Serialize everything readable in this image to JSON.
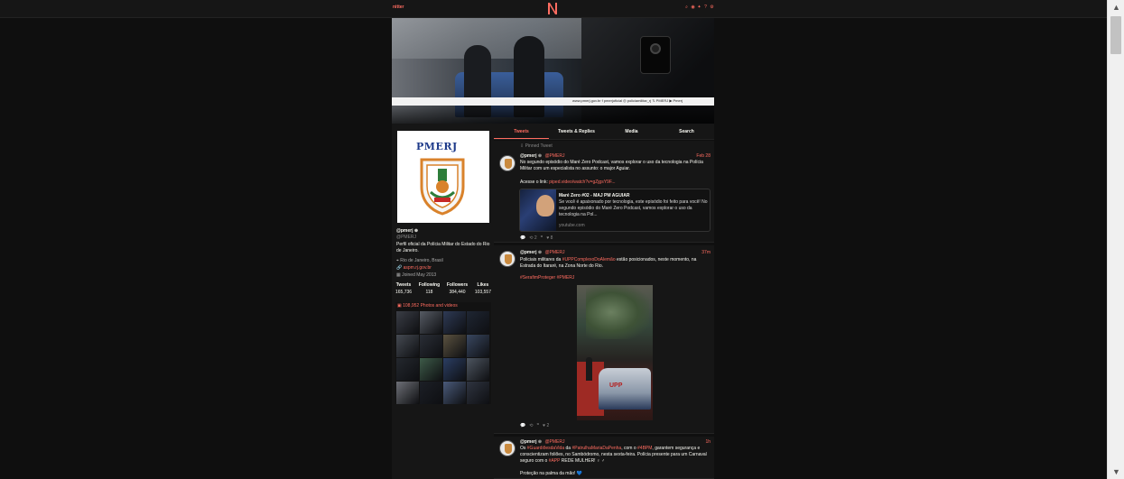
{
  "nav": {
    "brand": "nitter",
    "icons": [
      "search-icon",
      "rss-icon",
      "twitter-icon",
      "info-icon",
      "settings-icon"
    ],
    "icon_glyphs": [
      "⌕",
      "◉",
      "✦",
      "?",
      "⚙"
    ]
  },
  "banner": {
    "strip_text": "www.pmerj.gov.br   f pmerjoficial   ◎ policiamilitar_rj   𝕏 PMERJ   ▶ Pmerj"
  },
  "profile": {
    "logo_text": "PMERJ",
    "fullname": "@pmerj",
    "handle": "@PMERJ",
    "bio": "Perfil oficial da Polícia Militar do Estado do Rio de Janeiro.",
    "location": "Rio de Janeiro, Brasil",
    "website": "aspm.rj.gov.br",
    "joined": "Joined May 2013",
    "stats": [
      {
        "label": "Tweets",
        "value": "165,736"
      },
      {
        "label": "Following",
        "value": "118"
      },
      {
        "label": "Followers",
        "value": "384,440"
      },
      {
        "label": "Likes",
        "value": "103,557"
      }
    ],
    "media_label": "108,952 Photos and videos"
  },
  "tabs": [
    "Tweets",
    "Tweets & Replies",
    "Media",
    "Search"
  ],
  "tweets": [
    {
      "pinned": "Pinned Tweet",
      "fullname": "@pmerj",
      "username": "@PMERJ",
      "date": "Feb 28",
      "text1": "No segundo episódio do Maré Zero Podcast, vamos explorar o uso da tecnologia na Polícia Militar com um especialista no assunto: o major Aguiar.",
      "text2": "Acesse o link: ",
      "link": "piped.video/watch?v=gZjgsY9F...",
      "card": {
        "title": "Maré Zero #02 - MAJ PM AGUIAR",
        "desc": "Se você é apaixonado por tecnologia, este episódio foi feito para você! No segundo episódio do Maré Zero Podcast, vamos explorar o uso da tecnologia na Pol...",
        "domain": "youtube.com"
      },
      "replies": "",
      "retweets": "2",
      "quotes": "",
      "likes": "8"
    },
    {
      "fullname": "@pmerj",
      "username": "@PMERJ",
      "date": "37m",
      "pre": "Policiais militares da ",
      "tag1": "#UPPComplexoDoAlemão",
      "post": " estão posicionados, neste momento, na Estrada do Itararé, na Zona Norte do Rio.",
      "tags2": "#SerafimProteger #PMERJ",
      "photo_label": "UPP",
      "replies": "",
      "retweets": "",
      "quotes": "",
      "likes": "2"
    },
    {
      "fullname": "@pmerj",
      "username": "@PMERJ",
      "date": "1h",
      "p1": "Os ",
      "h1": "#GuardiõesdaVida",
      "p2": " da ",
      "h2": "#PatrulhaMariaDaPenha",
      "p3": ", com o ",
      "h3": "#4BPM",
      "p4": ", garantem segurança e conscientizam foliões, no Sambódromo, nesta sexta-feira. Polícia presente para um Carnaval seguro com o ",
      "h4": "#APP",
      "p5": " REDE MULHER! ♀ ♂",
      "line2": "Proteção na palma da mão! 💙"
    }
  ],
  "colors": {
    "accent": "#ff6c60",
    "background": "#0f0f0f",
    "panel": "#161616",
    "text": "#f8f8f2"
  },
  "media_thumb_colors": [
    "#3a3d45",
    "#565b64",
    "#2e3a55",
    "#1f2633",
    "#454a52",
    "#2a2e36",
    "#5b5240",
    "#394760",
    "#24282e",
    "#3d5a48",
    "#2b3e63",
    "#4d5560",
    "#6e7077",
    "#1c1f26",
    "#4a5a7a",
    "#2f3440"
  ]
}
